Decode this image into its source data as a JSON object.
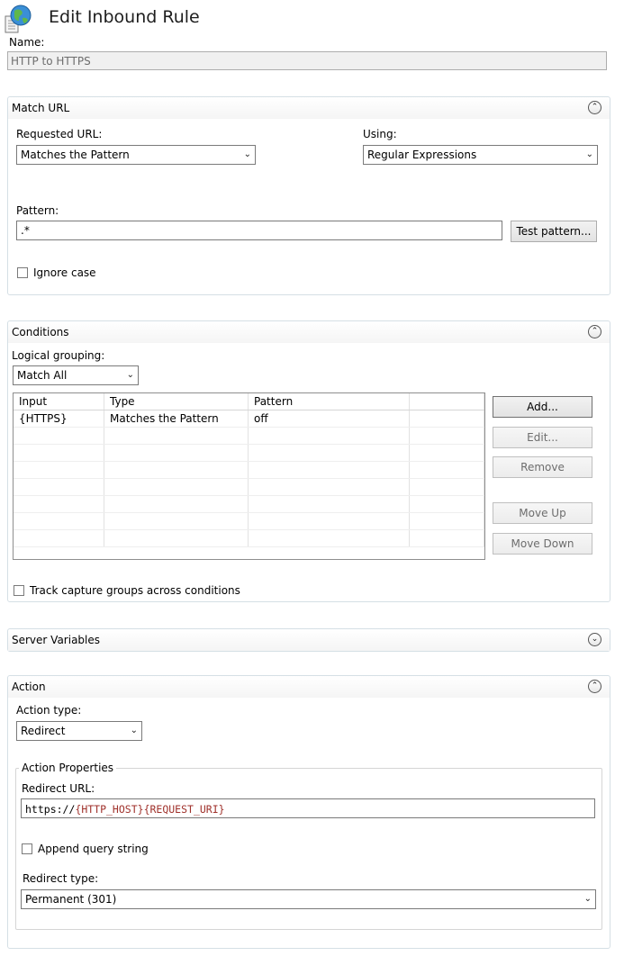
{
  "header": {
    "title": "Edit Inbound Rule",
    "icon": "globe-document-icon"
  },
  "name_field": {
    "label": "Name:",
    "value": "HTTP to HTTPS"
  },
  "match_url": {
    "title": "Match URL",
    "requested_url_label": "Requested URL:",
    "requested_url_value": "Matches the Pattern",
    "using_label": "Using:",
    "using_value": "Regular Expressions",
    "pattern_label": "Pattern:",
    "pattern_value": ".*",
    "test_pattern_button": "Test pattern...",
    "ignore_case_label": "Ignore case",
    "ignore_case_checked": false
  },
  "conditions": {
    "title": "Conditions",
    "logical_grouping_label": "Logical grouping:",
    "logical_grouping_value": "Match All",
    "columns": [
      "Input",
      "Type",
      "Pattern"
    ],
    "rows": [
      {
        "input": "{HTTPS}",
        "type": "Matches the Pattern",
        "pattern": "off"
      }
    ],
    "buttons": {
      "add": "Add...",
      "edit": "Edit...",
      "remove": "Remove",
      "move_up": "Move Up",
      "move_down": "Move Down"
    },
    "track_capture_label": "Track capture groups across conditions",
    "track_capture_checked": false
  },
  "server_variables": {
    "title": "Server Variables"
  },
  "action": {
    "title": "Action",
    "action_type_label": "Action type:",
    "action_type_value": "Redirect",
    "properties_title": "Action Properties",
    "redirect_url_label": "Redirect URL:",
    "redirect_url_prefix": "https://",
    "redirect_url_var1": "{HTTP_HOST}",
    "redirect_url_var2": "{REQUEST_URI}",
    "append_query_label": "Append query string",
    "append_query_checked": false,
    "redirect_type_label": "Redirect type:",
    "redirect_type_value": "Permanent (301)"
  },
  "colors": {
    "section_border": "#d5dfe5",
    "variable_text": "#a0322c",
    "disabled_text": "#6d6d6d"
  }
}
